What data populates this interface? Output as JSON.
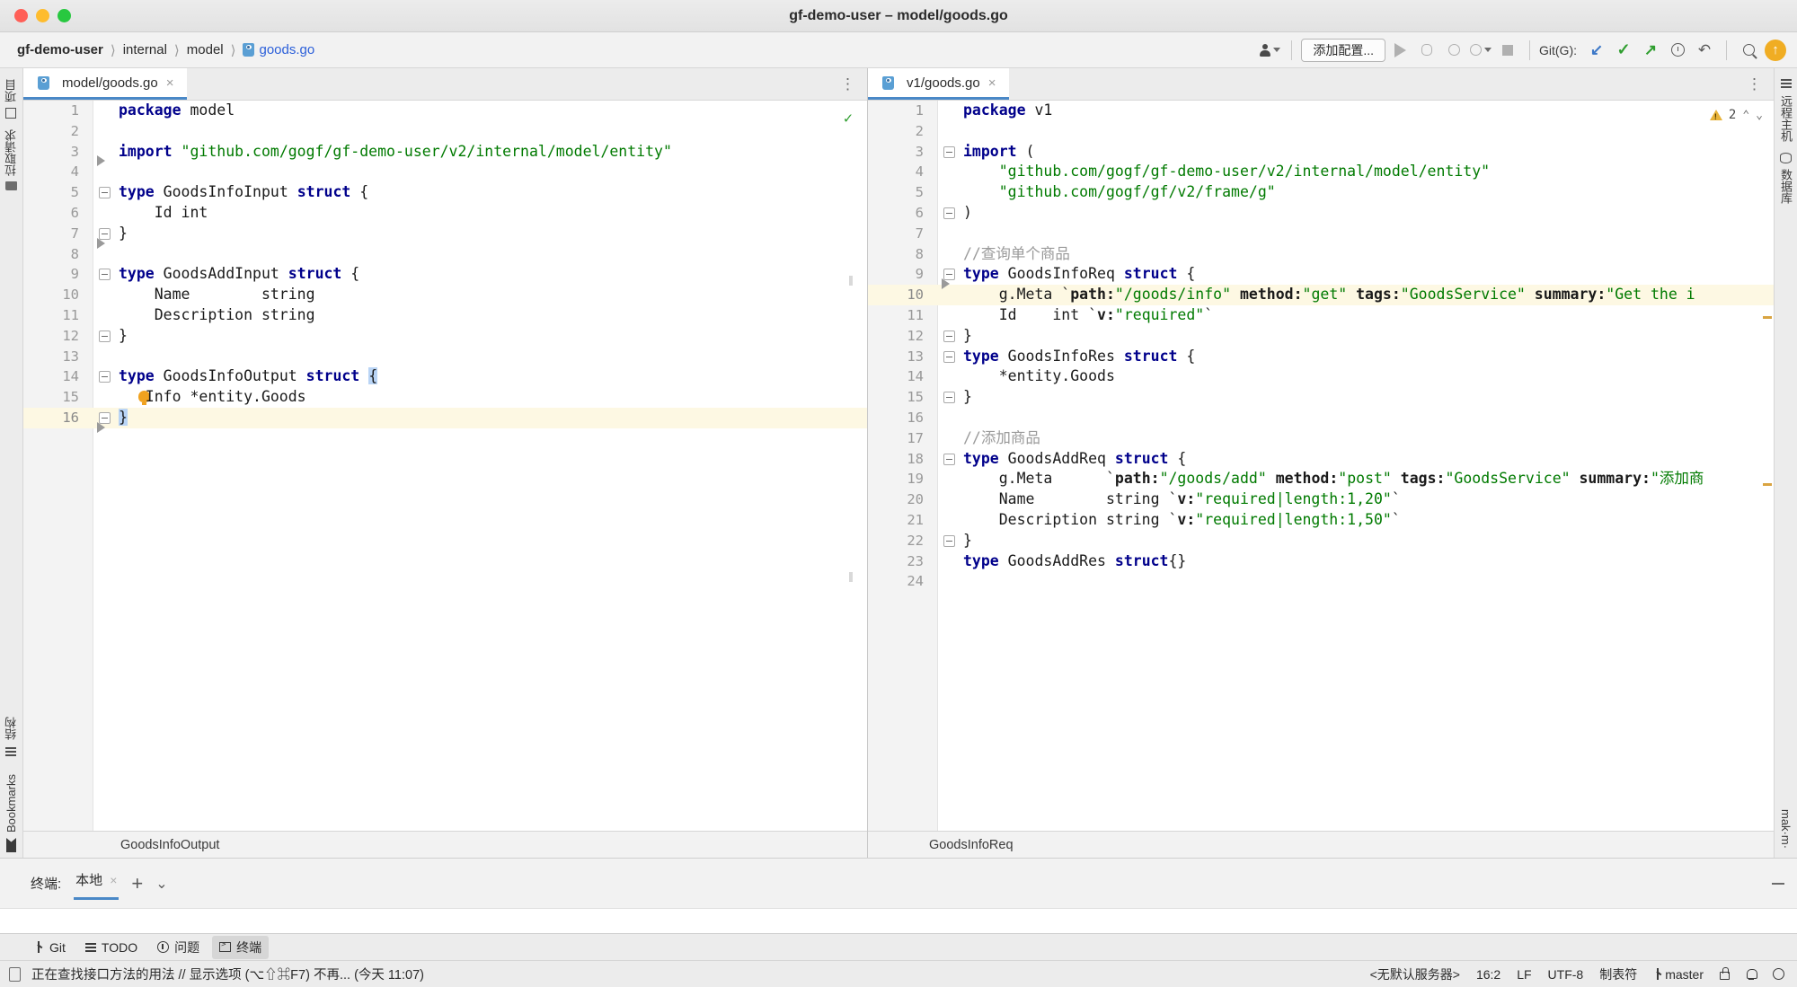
{
  "window": {
    "title": "gf-demo-user – model/goods.go",
    "traffic_lights": [
      "close-red",
      "minimize-yellow",
      "zoom-green"
    ]
  },
  "breadcrumb": {
    "items": [
      "gf-demo-user",
      "internal",
      "model",
      "goods.go"
    ],
    "separator": "〉"
  },
  "toolbar": {
    "user_icon": "person-icon",
    "config_button": "添加配置...",
    "run_icon": "run-icon",
    "debug_icon": "debug-icon",
    "coverage_icon": "run-coverage-icon",
    "profile_icon": "run-profile-icon",
    "stop_icon": "stop-icon",
    "git_label": "Git(G):",
    "git_update": "↙",
    "git_commit": "✓",
    "git_push": "↗",
    "history_icon": "history-icon",
    "rollback_icon": "rollback-icon",
    "search_icon": "search-everywhere-icon",
    "avatar": "↑"
  },
  "left_strip": {
    "items": [
      {
        "label": "项目",
        "icon": "project-icon"
      },
      {
        "label": "拉取请求",
        "icon": "pull-requests-icon"
      },
      {
        "label": "结构",
        "icon": "structure-icon"
      },
      {
        "label": "Bookmarks",
        "icon": "bookmarks-icon"
      }
    ]
  },
  "right_strip": {
    "items": [
      {
        "label": "远程主机",
        "icon": "remote-host-icon"
      },
      {
        "label": "数据库",
        "icon": "database-icon"
      },
      {
        "label": "mak·m·",
        "icon": "makefile-icon"
      }
    ]
  },
  "editors": {
    "left": {
      "tab": {
        "label": "model/goods.go",
        "close": "×",
        "icon": "go-file-icon"
      },
      "tab_menu": "⋮",
      "status_icon": "inspection-ok-icon",
      "status_glyph": "✓",
      "breadcrumb": "GoodsInfoOutput",
      "current_line": 16,
      "lines": [
        {
          "n": 1,
          "tokens": [
            {
              "t": "package",
              "c": "kw"
            },
            {
              "t": " model",
              "c": "plain"
            }
          ]
        },
        {
          "n": 2,
          "tokens": []
        },
        {
          "n": 3,
          "tokens": [
            {
              "t": "import ",
              "c": "kw"
            },
            {
              "t": "\"github.com/gogf/gf-demo-user/v2/internal/model/entity\"",
              "c": "str"
            }
          ]
        },
        {
          "n": 4,
          "tokens": [],
          "runmark": true
        },
        {
          "n": 5,
          "tokens": [
            {
              "t": "type",
              "c": "kw"
            },
            {
              "t": " GoodsInfoInput ",
              "c": "plain"
            },
            {
              "t": "struct",
              "c": "kw"
            },
            {
              "t": " {",
              "c": "plain"
            }
          ],
          "fold": "start"
        },
        {
          "n": 6,
          "tokens": [
            {
              "t": "    Id int",
              "c": "plain"
            }
          ]
        },
        {
          "n": 7,
          "tokens": [
            {
              "t": "}",
              "c": "plain"
            }
          ],
          "fold": "end"
        },
        {
          "n": 8,
          "tokens": [],
          "runmark": true
        },
        {
          "n": 9,
          "tokens": [
            {
              "t": "type",
              "c": "kw"
            },
            {
              "t": " GoodsAddInput ",
              "c": "plain"
            },
            {
              "t": "struct",
              "c": "kw"
            },
            {
              "t": " {",
              "c": "plain"
            }
          ],
          "fold": "start"
        },
        {
          "n": 10,
          "tokens": [
            {
              "t": "    Name        string",
              "c": "plain"
            }
          ]
        },
        {
          "n": 11,
          "tokens": [
            {
              "t": "    Description string",
              "c": "plain"
            }
          ]
        },
        {
          "n": 12,
          "tokens": [
            {
              "t": "}",
              "c": "plain"
            }
          ],
          "fold": "end"
        },
        {
          "n": 13,
          "tokens": []
        },
        {
          "n": 14,
          "tokens": [
            {
              "t": "type",
              "c": "kw"
            },
            {
              "t": " GoodsInfoOutput ",
              "c": "plain"
            },
            {
              "t": "struct",
              "c": "kw"
            },
            {
              "t": " ",
              "c": "plain"
            },
            {
              "t": "{",
              "c": "plain brace-hl"
            }
          ],
          "fold": "start"
        },
        {
          "n": 15,
          "tokens": [
            {
              "t": "   Info *entity.Goods",
              "c": "plain"
            }
          ],
          "bulb": true
        },
        {
          "n": 16,
          "tokens": [
            {
              "t": "}",
              "c": "plain brace-hl"
            }
          ],
          "fold": "end",
          "current": true,
          "runmark_below": true
        }
      ]
    },
    "right": {
      "tab": {
        "label": "v1/goods.go",
        "close": "×",
        "icon": "go-file-icon"
      },
      "tab_menu": "⋮",
      "warning_count": "2",
      "warning_icon": "warning-triangle-icon",
      "chev_up": "⌃",
      "chev_down": "⌄",
      "breadcrumb": "GoodsInfoReq",
      "current_line": 10,
      "lines": [
        {
          "n": 1,
          "tokens": [
            {
              "t": "package",
              "c": "kw"
            },
            {
              "t": " v1",
              "c": "plain"
            }
          ]
        },
        {
          "n": 2,
          "tokens": []
        },
        {
          "n": 3,
          "tokens": [
            {
              "t": "import",
              "c": "kw"
            },
            {
              "t": " (",
              "c": "plain"
            }
          ],
          "fold": "start"
        },
        {
          "n": 4,
          "tokens": [
            {
              "t": "    \"github.com/gogf/gf-demo-user/v2/internal/model/entity\"",
              "c": "str"
            }
          ]
        },
        {
          "n": 5,
          "tokens": [
            {
              "t": "    \"github.com/gogf/gf/v2/frame/g\"",
              "c": "str"
            }
          ]
        },
        {
          "n": 6,
          "tokens": [
            {
              "t": ")",
              "c": "plain"
            }
          ],
          "fold": "end"
        },
        {
          "n": 7,
          "tokens": []
        },
        {
          "n": 8,
          "tokens": [
            {
              "t": "//查询单个商品",
              "c": "cmt"
            }
          ]
        },
        {
          "n": 9,
          "tokens": [
            {
              "t": "type",
              "c": "kw"
            },
            {
              "t": " GoodsInfoReq ",
              "c": "plain"
            },
            {
              "t": "struct",
              "c": "kw"
            },
            {
              "t": " {",
              "c": "plain"
            }
          ],
          "fold": "start"
        },
        {
          "n": 10,
          "tokens": [
            {
              "t": "    g.Meta ",
              "c": "plain"
            },
            {
              "t": "`",
              "c": "plain"
            },
            {
              "t": "path:",
              "c": "tagk"
            },
            {
              "t": "\"/goods/info\"",
              "c": "str"
            },
            {
              "t": " method:",
              "c": "tagk"
            },
            {
              "t": "\"get\"",
              "c": "str"
            },
            {
              "t": " tags:",
              "c": "tagk"
            },
            {
              "t": "\"GoodsService\"",
              "c": "str"
            },
            {
              "t": " summary:",
              "c": "tagk"
            },
            {
              "t": "\"Get the i",
              "c": "str"
            }
          ],
          "current": true,
          "runmark": true
        },
        {
          "n": 11,
          "tokens": [
            {
              "t": "    Id    int ",
              "c": "plain"
            },
            {
              "t": "`",
              "c": "plain"
            },
            {
              "t": "v:",
              "c": "tagk"
            },
            {
              "t": "\"required\"",
              "c": "str"
            },
            {
              "t": "`",
              "c": "plain"
            }
          ]
        },
        {
          "n": 12,
          "tokens": [
            {
              "t": "}",
              "c": "plain"
            }
          ],
          "fold": "end"
        },
        {
          "n": 13,
          "tokens": [
            {
              "t": "type",
              "c": "kw"
            },
            {
              "t": " GoodsInfoRes ",
              "c": "plain"
            },
            {
              "t": "struct",
              "c": "kw"
            },
            {
              "t": " {",
              "c": "plain"
            }
          ],
          "fold": "start"
        },
        {
          "n": 14,
          "tokens": [
            {
              "t": "    *entity.Goods",
              "c": "plain"
            }
          ]
        },
        {
          "n": 15,
          "tokens": [
            {
              "t": "}",
              "c": "plain"
            }
          ],
          "fold": "end"
        },
        {
          "n": 16,
          "tokens": []
        },
        {
          "n": 17,
          "tokens": [
            {
              "t": "//添加商品",
              "c": "cmt"
            }
          ]
        },
        {
          "n": 18,
          "tokens": [
            {
              "t": "type",
              "c": "kw"
            },
            {
              "t": " GoodsAddReq ",
              "c": "plain"
            },
            {
              "t": "struct",
              "c": "kw"
            },
            {
              "t": " {",
              "c": "plain"
            }
          ],
          "fold": "start"
        },
        {
          "n": 19,
          "tokens": [
            {
              "t": "    g.Meta      ",
              "c": "plain"
            },
            {
              "t": "`",
              "c": "plain"
            },
            {
              "t": "path:",
              "c": "tagk"
            },
            {
              "t": "\"/goods/add\"",
              "c": "str"
            },
            {
              "t": " method:",
              "c": "tagk"
            },
            {
              "t": "\"post\"",
              "c": "str"
            },
            {
              "t": " tags:",
              "c": "tagk"
            },
            {
              "t": "\"GoodsService\"",
              "c": "str"
            },
            {
              "t": " summary:",
              "c": "tagk"
            },
            {
              "t": "\"添加商",
              "c": "str"
            }
          ]
        },
        {
          "n": 20,
          "tokens": [
            {
              "t": "    Name        string ",
              "c": "plain"
            },
            {
              "t": "`",
              "c": "plain"
            },
            {
              "t": "v:",
              "c": "tagk"
            },
            {
              "t": "\"required|length:1,20\"",
              "c": "str"
            },
            {
              "t": "`",
              "c": "plain"
            }
          ]
        },
        {
          "n": 21,
          "tokens": [
            {
              "t": "    Description string ",
              "c": "plain"
            },
            {
              "t": "`",
              "c": "plain"
            },
            {
              "t": "v:",
              "c": "tagk"
            },
            {
              "t": "\"required|length:1,50\"",
              "c": "str"
            },
            {
              "t": "`",
              "c": "plain"
            }
          ]
        },
        {
          "n": 22,
          "tokens": [
            {
              "t": "}",
              "c": "plain"
            }
          ],
          "fold": "end"
        },
        {
          "n": 23,
          "tokens": [
            {
              "t": "type",
              "c": "kw"
            },
            {
              "t": " GoodsAddRes ",
              "c": "plain"
            },
            {
              "t": "struct",
              "c": "kw"
            },
            {
              "t": "{}",
              "c": "plain"
            }
          ]
        },
        {
          "n": 24,
          "tokens": []
        }
      ]
    }
  },
  "terminal": {
    "label": "终端:",
    "tab": "本地",
    "tab_close": "×",
    "add": "+",
    "dropdown": "⌄",
    "minimize": "minimize-icon"
  },
  "bottom_bar": {
    "items": [
      {
        "label": "Git",
        "icon": "git-branch-icon",
        "active": false
      },
      {
        "label": "TODO",
        "icon": "todo-icon",
        "active": false
      },
      {
        "label": "问题",
        "icon": "problems-icon",
        "active": false
      },
      {
        "label": "终端",
        "icon": "terminal-icon",
        "active": true
      }
    ]
  },
  "status_bar": {
    "message_icon": "document-icon",
    "message": "正在查找接口方法的用法 // 显示选项 (⌥⇧⌘F7)  不再... (今天 11:07)",
    "server": "<无默认服务器>",
    "caret": "16:2",
    "line_sep": "LF",
    "encoding": "UTF-8",
    "indent": "制表符",
    "branch": "master",
    "lock_icon": "lock-icon",
    "notification_icon": "notification-icon",
    "settings_icon": "settings-icon"
  },
  "colors": {
    "accent": "#4a88c7",
    "keyword": "#00008b",
    "string": "#007a00",
    "comment": "#9a9a9a",
    "current_line": "#fdf8e3",
    "brace_highlight": "#b9d4f5",
    "avatar": "#f0ad23"
  }
}
